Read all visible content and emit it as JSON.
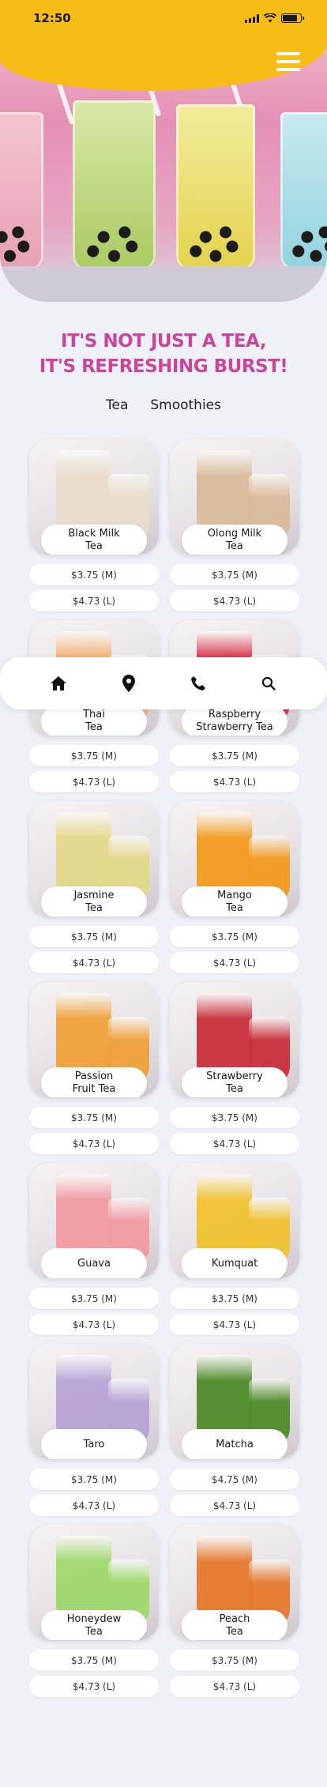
{
  "status": {
    "time": "12:50"
  },
  "hero": {
    "headline_line1": "IT'S NOT JUST A TEA,",
    "headline_line2": "IT'S REFRESHING BURST!"
  },
  "tabs": [
    "Tea",
    "Smoothies"
  ],
  "colors": {
    "accent_yellow": "#f8bc17",
    "headline_pink": "#c8479d",
    "background": "#eff0f8"
  },
  "nav": {
    "icons": [
      "home-icon",
      "location-pin-icon",
      "phone-icon",
      "search-icon"
    ]
  },
  "products": [
    {
      "name": "Black Milk\nTea",
      "price_m": "$3.75 (M)",
      "price_l": "$4.73 (L)",
      "tone": "#e9dccb"
    },
    {
      "name": "Olong Milk\nTea",
      "price_m": "$3.75 (M)",
      "price_l": "$4.73 (L)",
      "tone": "#d9bb9a"
    },
    {
      "name": "Thai\nTea",
      "price_m": "$3.75 (M)",
      "price_l": "$4.73 (L)",
      "tone": "#f0b072"
    },
    {
      "name": "Raspberry\nStrawberry Tea",
      "price_m": "$3.75 (M)",
      "price_l": "$4.73 (L)",
      "tone": "#d8324a"
    },
    {
      "name": "Jasmine\nTea",
      "price_m": "$3.75 (M)",
      "price_l": "$4.73 (L)",
      "tone": "#e4d889"
    },
    {
      "name": "Mango\nTea",
      "price_m": "$3.75 (M)",
      "price_l": "$4.73 (L)",
      "tone": "#f39a1f"
    },
    {
      "name": "Passion\nFruit Tea",
      "price_m": "$3.75 (M)",
      "price_l": "$4.73 (L)",
      "tone": "#f0a03a"
    },
    {
      "name": "Strawberry\nTea",
      "price_m": "$3.75 (M)",
      "price_l": "$4.73 (L)",
      "tone": "#c92f3a"
    },
    {
      "name": "Guava",
      "price_m": "$3.75 (M)",
      "price_l": "$4.73 (L)",
      "tone": "#f29aa3"
    },
    {
      "name": "Kumquat",
      "price_m": "$3.75 (M)",
      "price_l": "$4.73 (L)",
      "tone": "#f1c230"
    },
    {
      "name": "Taro",
      "price_m": "$3.75 (M)",
      "price_l": "$4.73 (L)",
      "tone": "#b7a4d6"
    },
    {
      "name": "Matcha",
      "price_m": "$4.75 (M)",
      "price_l": "$4.73 (L)",
      "tone": "#4f8c2a"
    },
    {
      "name": "Honeydew\nTea",
      "price_m": "$3.75 (M)",
      "price_l": "$4.73 (L)",
      "tone": "#9fd86a"
    },
    {
      "name": "Peach\nTea",
      "price_m": "$3.75 (M)",
      "price_l": "$4.73 (L)",
      "tone": "#e6792e"
    }
  ]
}
